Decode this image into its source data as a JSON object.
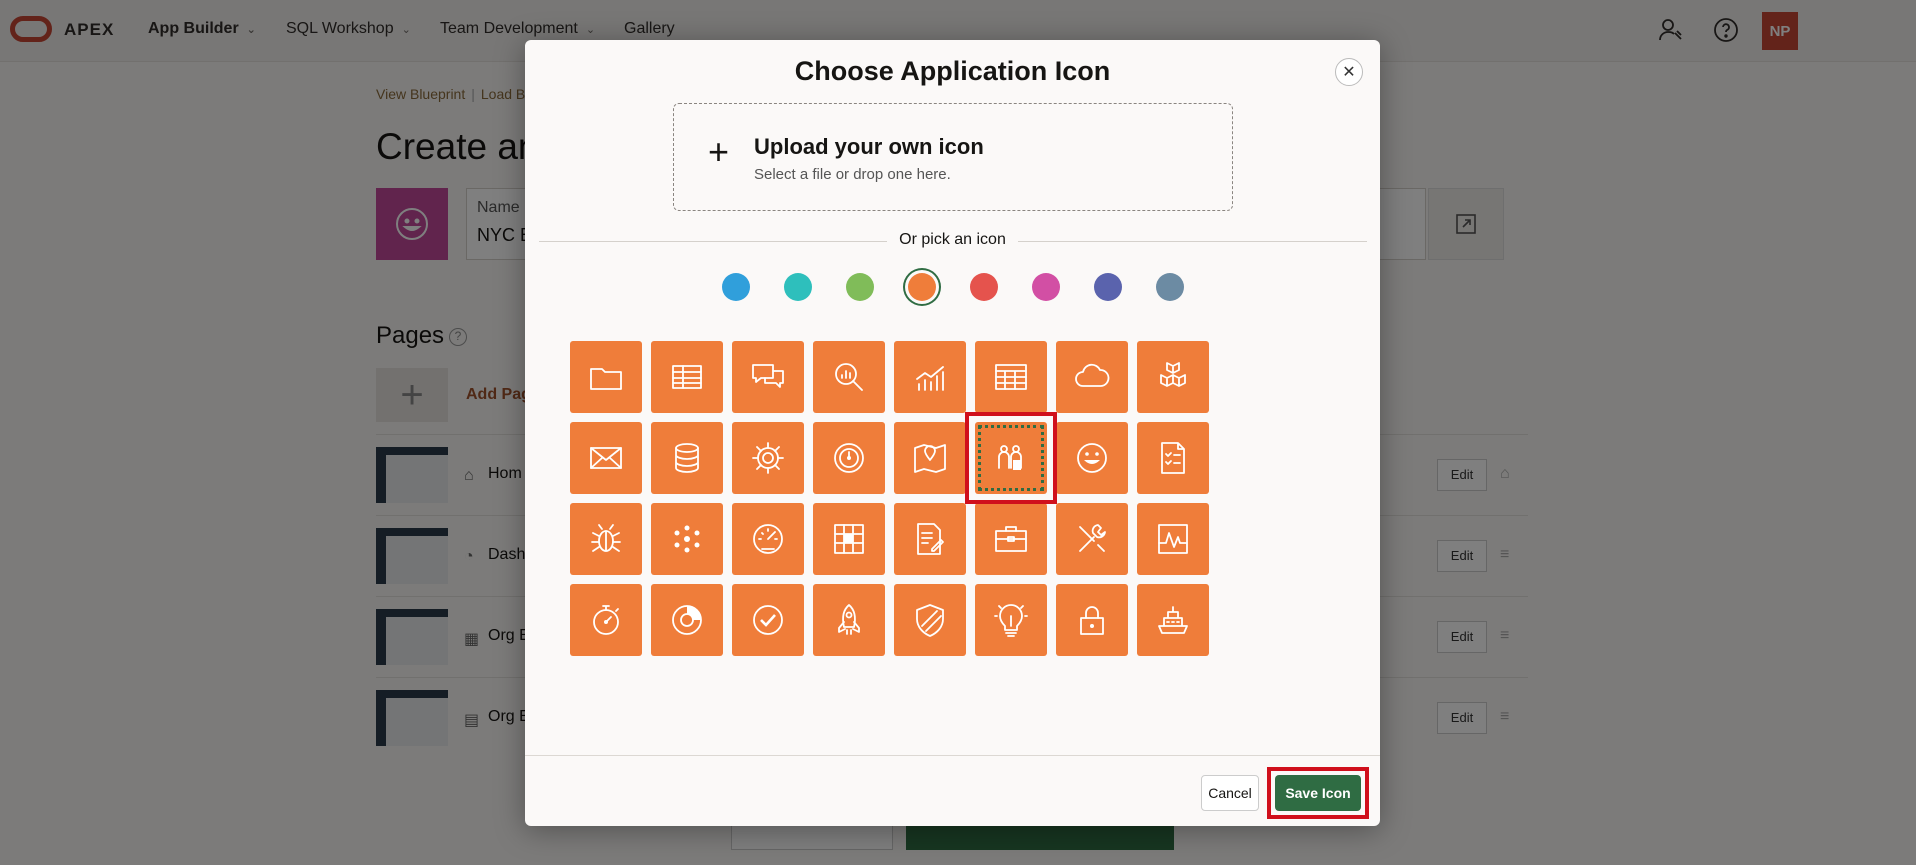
{
  "topbar": {
    "logo": "APEX",
    "nav": [
      {
        "label": "App Builder",
        "bold": true
      },
      {
        "label": "SQL Workshop",
        "bold": false
      },
      {
        "label": "Team Development",
        "bold": false
      },
      {
        "label": "Gallery",
        "bold": false
      }
    ],
    "avatar": "NP"
  },
  "background": {
    "breadcrumb": [
      "View Blueprint",
      "Load Bl"
    ],
    "page_title": "Create an",
    "name_label": "Name",
    "name_value": "NYC E",
    "pages_heading": "Pages",
    "add_page": "Add Pag",
    "pages": [
      {
        "icon": "⌂",
        "name": "Hom",
        "edit": "Edit"
      },
      {
        "icon": "◔",
        "name": "Dash",
        "edit": "Edit"
      },
      {
        "icon": "▦",
        "name": "Org E",
        "edit": "Edit"
      },
      {
        "icon": "▤",
        "name": "Org E",
        "edit": "Edit"
      }
    ]
  },
  "modal": {
    "title": "Choose Application Icon",
    "upload_title": "Upload your own icon",
    "upload_sub": "Select a file or drop one here.",
    "divider_label": "Or pick an icon",
    "colors": [
      "#309fdb",
      "#2ebfbc",
      "#80bc59",
      "#ef7d3a",
      "#e5534d",
      "#d24fa4",
      "#5a63ad",
      "#6c8ba3"
    ],
    "selected_color_index": 3,
    "icons": [
      "folder",
      "table",
      "chat",
      "search-chart",
      "bar-chart",
      "calendar-grid",
      "cloud",
      "boxes",
      "envelope",
      "database",
      "gear",
      "target",
      "map-pin",
      "people",
      "smiley",
      "checklist",
      "bug",
      "dots-flower",
      "speedometer",
      "grid-blocks",
      "document-pen",
      "briefcase",
      "tools",
      "pulse-line",
      "stopwatch",
      "donut",
      "check-circle",
      "rocket",
      "shield",
      "lightbulb",
      "padlock",
      "ship"
    ],
    "selected_icon_index": 13,
    "cancel_label": "Cancel",
    "save_label": "Save Icon"
  }
}
